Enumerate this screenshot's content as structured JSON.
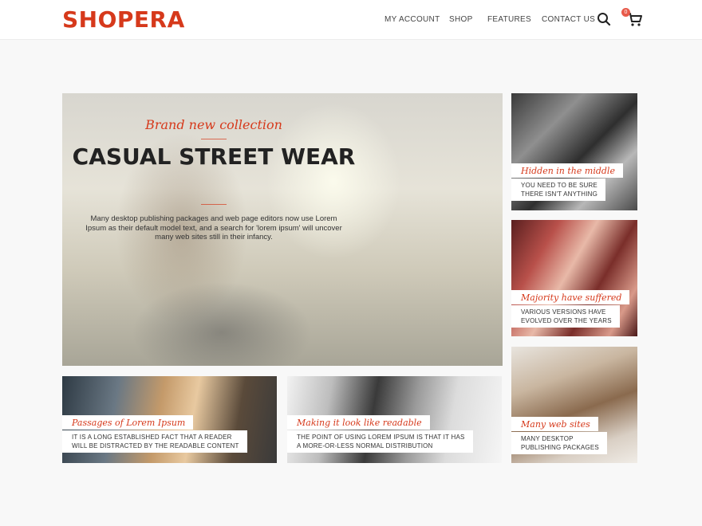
{
  "header": {
    "logo": "SHOPERA",
    "nav": [
      "MY ACCOUNT",
      "SHOP",
      "FEATURES",
      "CONTACT US"
    ],
    "cart_count": "0",
    "icons": [
      "search-icon",
      "cart-icon"
    ]
  },
  "hero": {
    "subtitle": "Brand new collection",
    "title": "CASUAL STREET WEAR",
    "text": "Many desktop publishing packages and web page editors now use Lorem Ipsum as their default model text, and a search for 'lorem ipsum' will uncover many web sites still in their infancy."
  },
  "tiles": [
    {
      "title": "Hidden in the middle",
      "line1": "YOU NEED TO BE SURE",
      "line2": "THERE ISN'T ANYTHING"
    },
    {
      "title": "Majority have suffered",
      "line1": "VARIOUS VERSIONS HAVE",
      "line2": "EVOLVED OVER THE YEARS"
    },
    {
      "title": "Many web sites",
      "line1": "MANY DESKTOP",
      "line2": "PUBLISHING PACKAGES"
    },
    {
      "title": "Passages of Lorem Ipsum",
      "line1": "IT IS A LONG ESTABLISHED FACT THAT A READER",
      "line2": "WILL BE DISTRACTED BY THE READABLE CONTENT"
    },
    {
      "title": "Making it look like readable",
      "line1": "THE POINT OF USING LOREM IPSUM IS THAT IT HAS",
      "line2": "A MORE-OR-LESS NORMAL DISTRIBUTION"
    }
  ],
  "colors": {
    "accent": "#d6391b",
    "badge": "#e85a4a",
    "background": "#f8f8f8"
  }
}
